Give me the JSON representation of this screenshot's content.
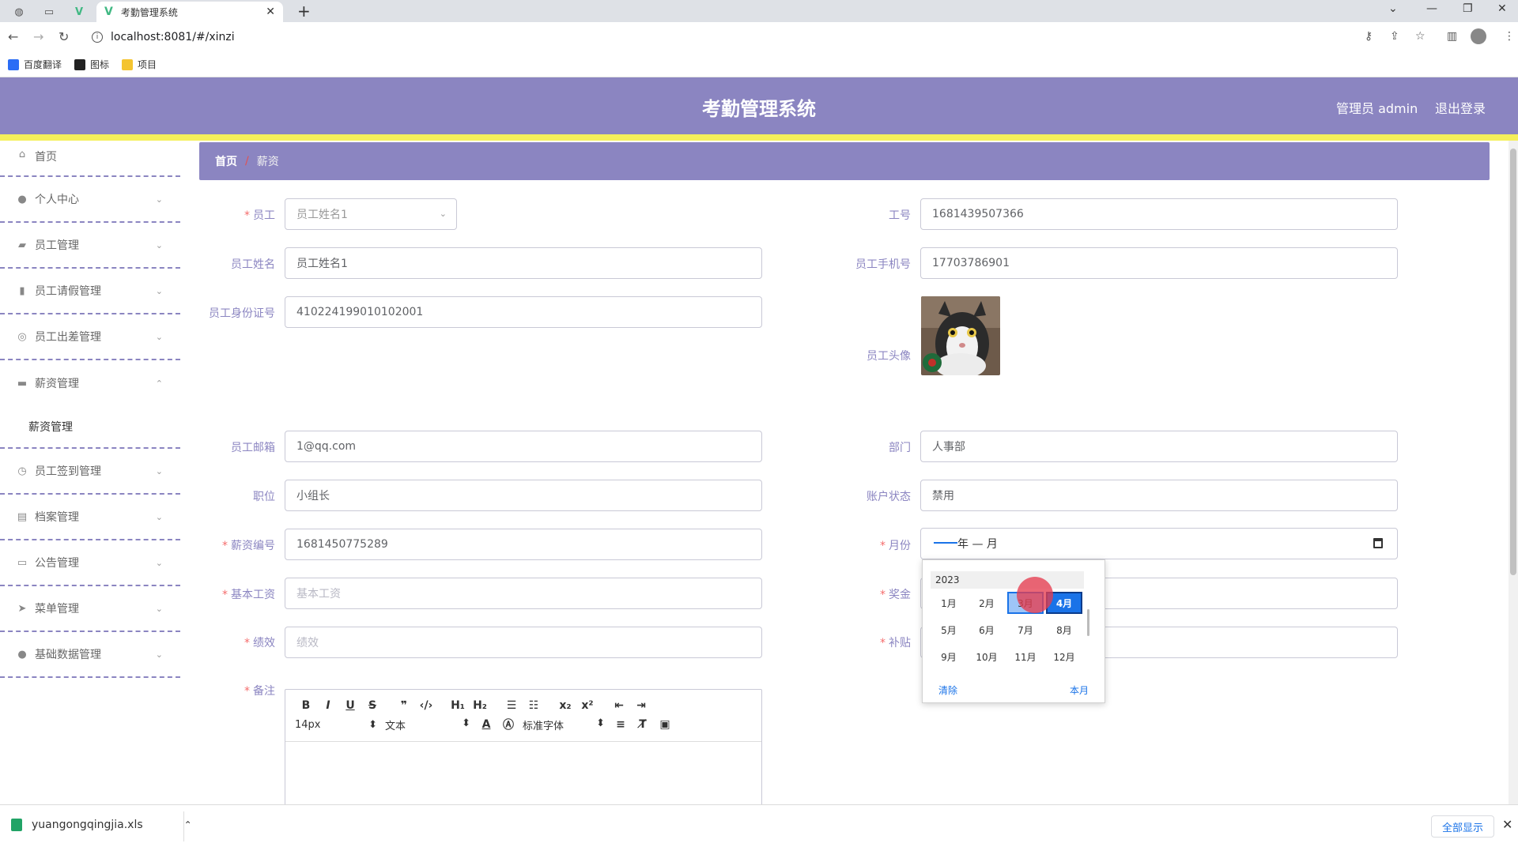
{
  "browser": {
    "tab_title": "考勤管理系统",
    "url": "localhost:8081/#/xinzi",
    "bookmarks": [
      {
        "label": "百度翻译",
        "color": "#2b6df5"
      },
      {
        "label": "图标",
        "color": "#222222"
      },
      {
        "label": "项目",
        "color": "#f4c430"
      }
    ]
  },
  "header": {
    "title": "考勤管理系统",
    "user": "管理员 admin",
    "logout": "退出登录"
  },
  "sidebar": {
    "items": [
      {
        "label": "首页",
        "icon": "home-icon"
      },
      {
        "label": "个人中心",
        "icon": "user-icon"
      },
      {
        "label": "员工管理",
        "icon": "briefcase-icon"
      },
      {
        "label": "员工请假管理",
        "icon": "chart-icon"
      },
      {
        "label": "员工出差管理",
        "icon": "globe-icon"
      },
      {
        "label": "薪资管理",
        "icon": "wallet-icon"
      },
      {
        "label": "员工签到管理",
        "icon": "clock-icon"
      },
      {
        "label": "档案管理",
        "icon": "file-icon"
      },
      {
        "label": "公告管理",
        "icon": "monitor-icon"
      },
      {
        "label": "菜单管理",
        "icon": "send-icon"
      },
      {
        "label": "基础数据管理",
        "icon": "user-icon"
      }
    ],
    "sub_item": "薪资管理"
  },
  "breadcrumb": {
    "home": "首页",
    "sep": "/",
    "current": "薪资"
  },
  "form": {
    "employee_label": "员工",
    "employee_value": "员工姓名1",
    "jobno_label": "工号",
    "jobno_value": "1681439507366",
    "name_label": "员工姓名",
    "name_value": "员工姓名1",
    "phone_label": "员工手机号",
    "phone_value": "17703786901",
    "idcard_label": "员工身份证号",
    "idcard_value": "410224199010102001",
    "avatar_label": "员工头像",
    "email_label": "员工邮箱",
    "email_value": "1@qq.com",
    "dept_label": "部门",
    "dept_value": "人事部",
    "position_label": "职位",
    "position_value": "小组长",
    "status_label": "账户状态",
    "status_value": "禁用",
    "salaryno_label": "薪资编号",
    "salaryno_value": "1681450775289",
    "month_label": "月份",
    "month_value": "年 — 月",
    "basesalary_label": "基本工资",
    "basesalary_placeholder": "基本工资",
    "bonus_label": "奖金",
    "perf_label": "绩效",
    "perf_placeholder": "绩效",
    "subsidy_label": "补贴",
    "remark_label": "备注",
    "required_mark": "*"
  },
  "month_picker": {
    "year": "2023",
    "months": [
      "1月",
      "2月",
      "3月",
      "4月",
      "5月",
      "6月",
      "7月",
      "8月",
      "9月",
      "10月",
      "11月",
      "12月"
    ],
    "clear": "清除",
    "this_month": "本月"
  },
  "editor": {
    "font_size": "14px",
    "header": "文本",
    "font": "标准字体"
  },
  "download": {
    "filename": "yuangongqingjia.xls",
    "show_all": "全部显示"
  }
}
